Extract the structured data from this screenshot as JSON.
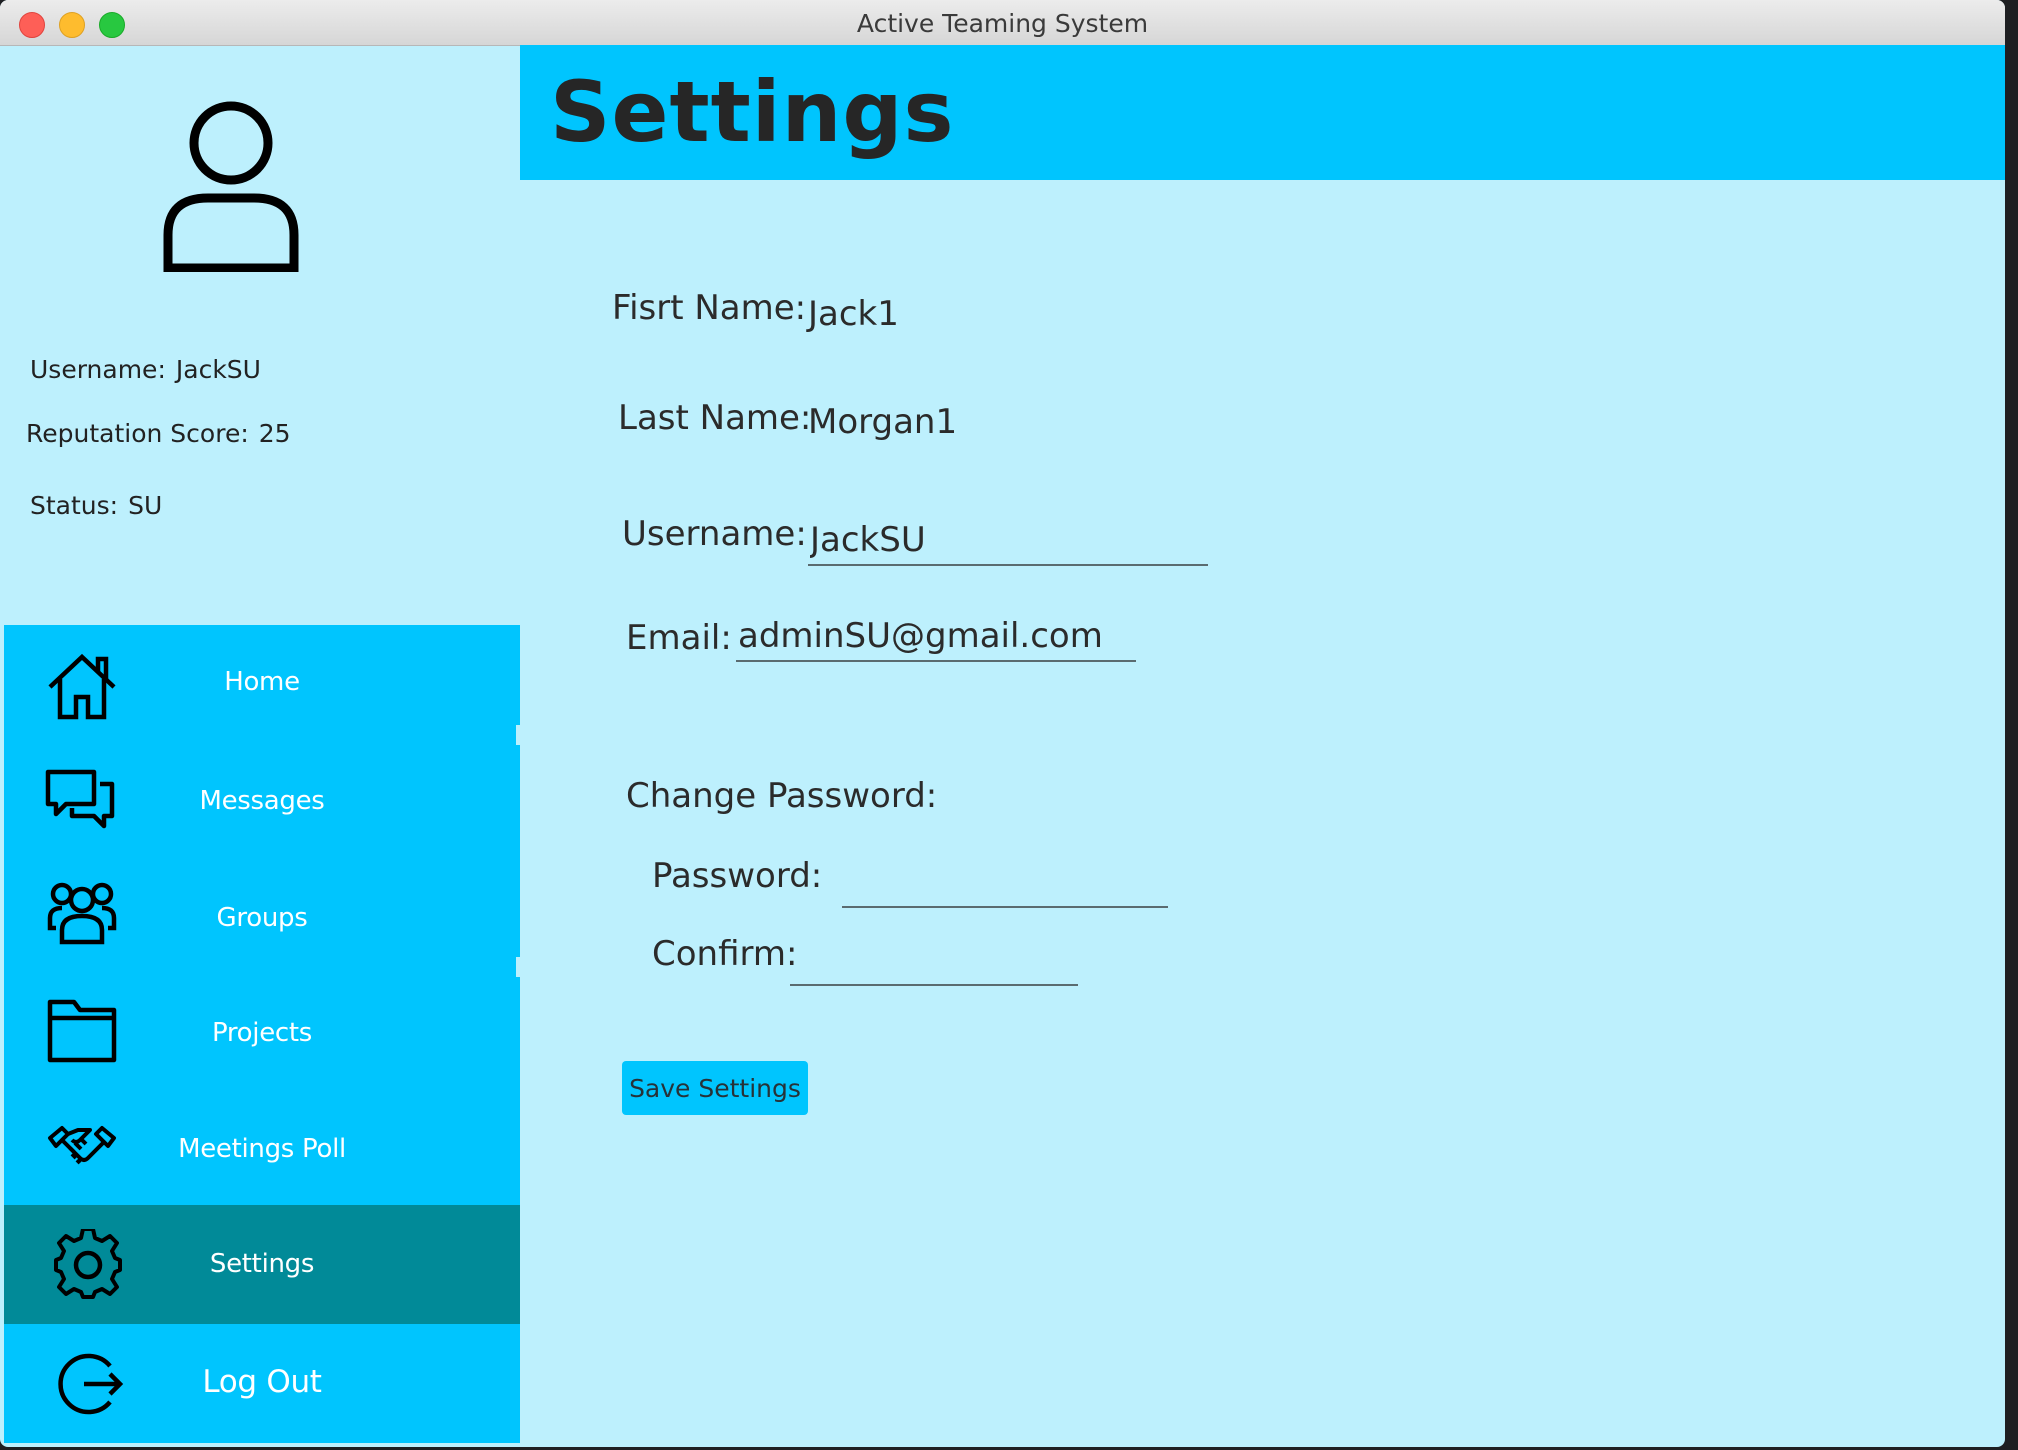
{
  "window": {
    "title": "Active Teaming System"
  },
  "profile": {
    "avatar_icon": "user-icon",
    "username_label": "Username:",
    "username_value": "JackSU",
    "reputation_label": "Reputation Score:",
    "reputation_value": "25",
    "status_label": "Status:",
    "status_value": "SU"
  },
  "nav": {
    "items": [
      {
        "label": "Home",
        "icon": "home-icon"
      },
      {
        "label": "Messages",
        "icon": "chat-bubbles-icon"
      },
      {
        "label": "Groups",
        "icon": "users-group-icon"
      },
      {
        "label": "Projects",
        "icon": "folder-icon"
      },
      {
        "label": "Meetings Poll",
        "icon": "handshake-icon"
      },
      {
        "label": "Settings",
        "icon": "gear-icon",
        "active": true
      },
      {
        "label": "Log Out",
        "icon": "logout-icon"
      }
    ]
  },
  "header": {
    "title": "Settings"
  },
  "form": {
    "first_name_label": "Fisrt Name:",
    "first_name_value": "Jack1",
    "last_name_label": "Last Name:",
    "last_name_value": "Morgan1",
    "username_label": "Username:",
    "username_value": "JackSU",
    "email_label": "Email:",
    "email_value": "adminSU@gmail.com",
    "change_password_label": "Change Password:",
    "password_label": "Password:",
    "password_value": "",
    "confirm_label": "Confirm:",
    "confirm_value": "",
    "save_button": "Save Settings"
  },
  "colors": {
    "background": "#bdf0fd",
    "accent": "#00c5fe",
    "active_nav": "#018a98",
    "text": "#2b2b2b"
  }
}
